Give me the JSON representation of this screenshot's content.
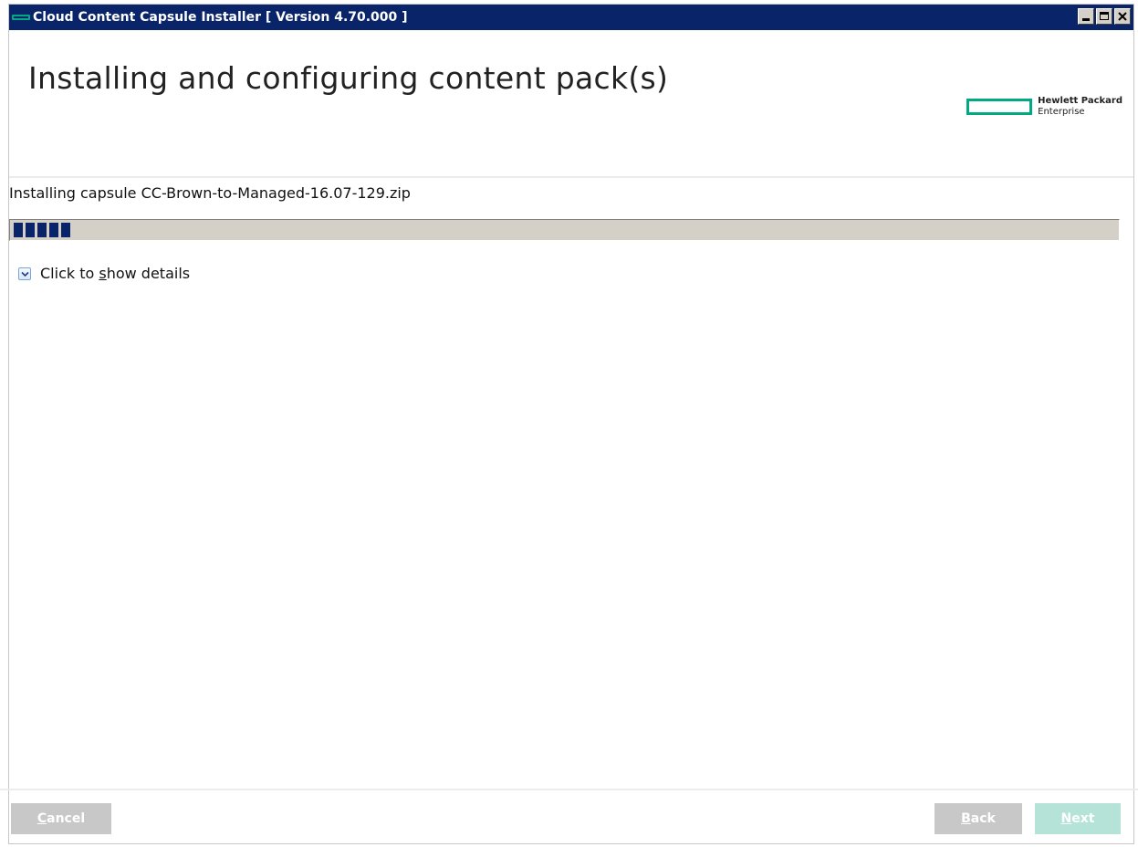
{
  "window": {
    "title": "Cloud Content Capsule Installer [ Version 4.70.000 ]"
  },
  "header": {
    "title": "Installing and configuring content pack(s)",
    "logo": {
      "line1": "Hewlett Packard",
      "line2": "Enterprise",
      "color": "#01a982"
    }
  },
  "status": {
    "text": "Installing capsule CC-Brown-to-Managed-16.07-129.zip",
    "progress_percent": 5
  },
  "details": {
    "label_prefix": "Click to ",
    "label_mnemonic": "s",
    "label_suffix": "how details",
    "icon": "chevron-down-icon"
  },
  "buttons": {
    "cancel": {
      "mnemonic": "C",
      "rest": "ancel",
      "enabled": false
    },
    "back": {
      "mnemonic": "B",
      "rest": "ack",
      "enabled": false
    },
    "next": {
      "mnemonic": "N",
      "rest": "ext",
      "enabled": false
    }
  },
  "colors": {
    "titlebar": "#0a246a",
    "accent": "#01a982",
    "button_disabled": "#c8c8c8",
    "next_disabled": "#b5e3d7"
  }
}
